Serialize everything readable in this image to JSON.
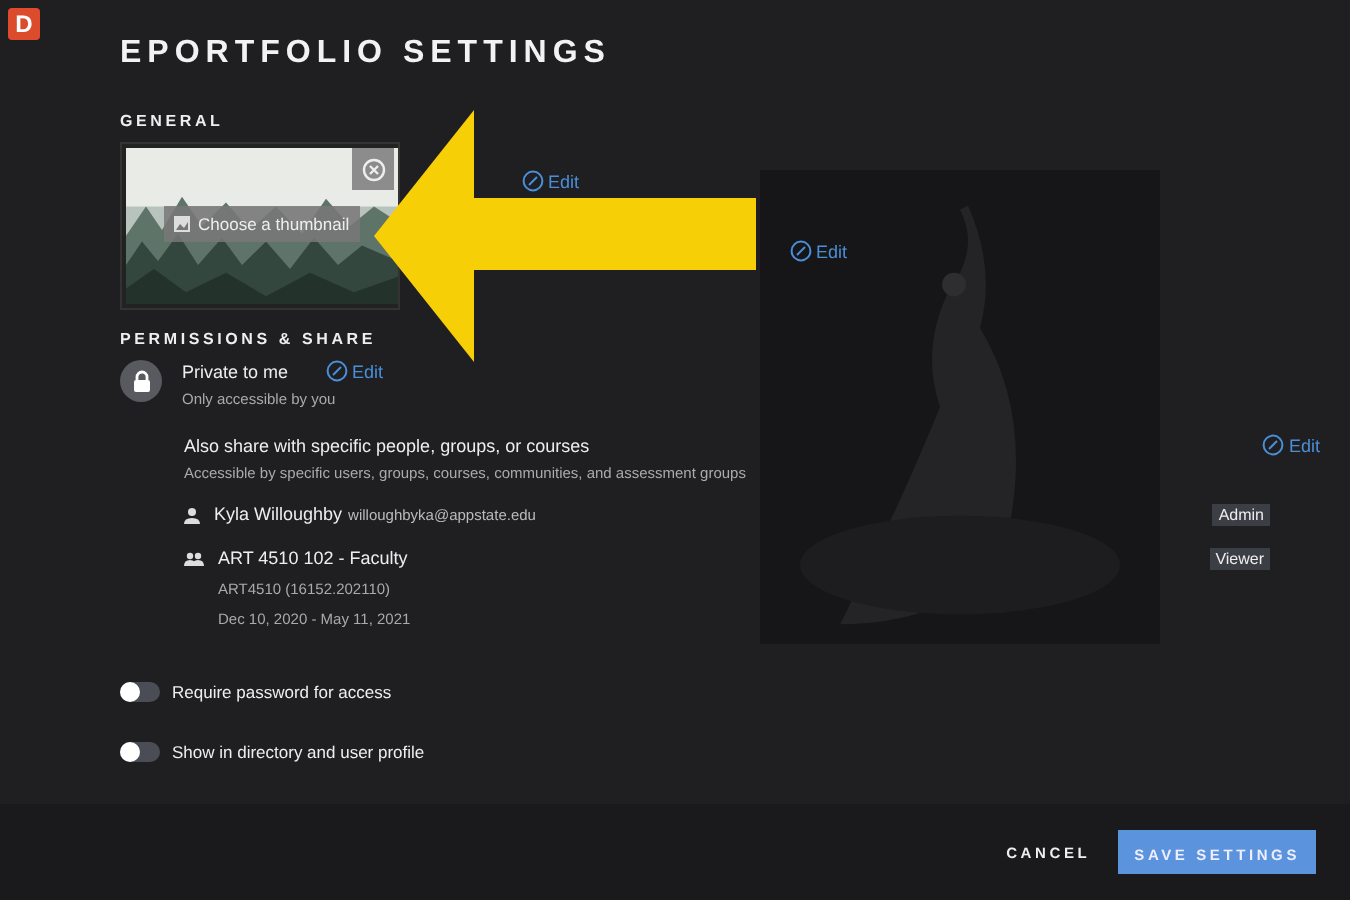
{
  "app_badge": "D",
  "title": "EPORTFOLIO SETTINGS",
  "general": {
    "heading": "GENERAL",
    "thumbnail": {
      "kind": "picture",
      "button": "Choose a thumbnail"
    },
    "edit_links": [
      "Edit",
      "Edit"
    ]
  },
  "permissions": {
    "heading": "PERMISSIONS & SHARE",
    "privacy": {
      "title": "Private to me",
      "subtitle": "Only accessible by you",
      "edit": "Edit"
    },
    "share": {
      "title": "Also share with specific people, groups, or courses",
      "subtitle": "Accessible by specific users, groups, courses, communities, and assessment groups",
      "edit": "Edit"
    },
    "members": [
      {
        "kind": "person",
        "name": "Kyla Willoughby",
        "email": "willoughbyka@appstate.edu",
        "role": "Admin"
      },
      {
        "kind": "group",
        "name": "ART 4510 102 - Faculty",
        "details": [
          "ART4510 (16152.202110)",
          "Dec 10, 2020 - May 11, 2021"
        ],
        "role": "Viewer"
      }
    ]
  },
  "toggles": [
    {
      "label": "Require password for access",
      "on": false
    },
    {
      "label": "Show in directory and user profile",
      "on": false
    }
  ],
  "buttons": {
    "cancel": "CANCEL",
    "save": "SAVE SETTINGS"
  }
}
